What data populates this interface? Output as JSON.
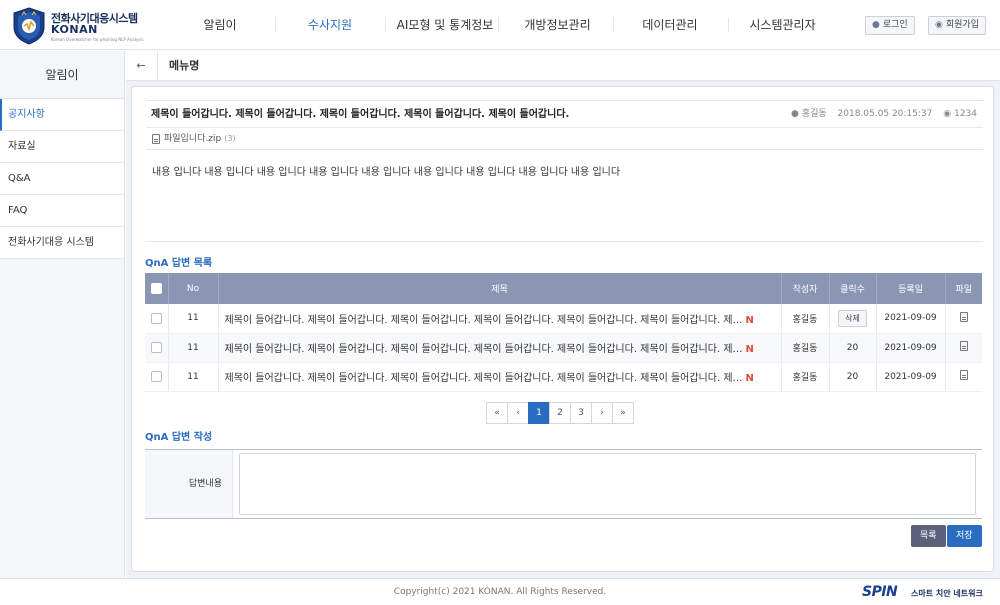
{
  "app": {
    "logo_title": "전화사기대응시스템",
    "logo_name": "KONAN",
    "logo_tagline": "Korean Overwatcher for phishing NLP Analysis"
  },
  "gnb": [
    {
      "label": "알림이",
      "active": false
    },
    {
      "label": "수사지원",
      "active": true
    },
    {
      "label": "AI모형 및 통계정보",
      "active": false
    },
    {
      "label": "개방정보관리",
      "active": false
    },
    {
      "label": "데이터관리",
      "active": false
    },
    {
      "label": "시스템관리자",
      "active": false
    }
  ],
  "top_buttons": {
    "login": "로그인",
    "signup": "회원가입"
  },
  "sidebar": {
    "title": "알림이",
    "items": [
      {
        "label": "공지사항",
        "active": true
      },
      {
        "label": "자료실",
        "active": false
      },
      {
        "label": "Q&A",
        "active": false
      },
      {
        "label": "FAQ",
        "active": false
      },
      {
        "label": "전화사기대응 시스템",
        "active": false
      }
    ]
  },
  "breadcrumb": {
    "title": "메뉴명"
  },
  "post": {
    "title": "제목이 들어갑니다. 제목이 들어갑니다. 제목이 들어갑니다. 제목이 들어갑니다. 제목이 들어갑니다.",
    "author": "홍길동",
    "date": "2018.05.05 20:15:37",
    "views": "1234",
    "file_name": "파일입니다.zip",
    "file_size": "(3)",
    "body": "내용 입니다 내용 입니다 내용 입니다 내용 입니다 내용 입니다 내용 입니다 내용 입니다 내용 입니다 내용 입니다"
  },
  "answers": {
    "section_title": "QnA 답변 목록",
    "headers": [
      "No",
      "제목",
      "작성자",
      "클릭수",
      "등록일",
      "파일"
    ],
    "rows": [
      {
        "no": "11",
        "title": "제목이 들어갑니다. 제목이 들어갑니다. 제목이 들어갑니다. 제목이 들어갑니다. 제목이 들어갑니다. 제목이 들어갑니다. 제…",
        "new": "N",
        "author": "홍길동",
        "clicks": "삭제",
        "clicks_is_button": true,
        "date": "2021-09-09"
      },
      {
        "no": "11",
        "title": "제목이 들어갑니다. 제목이 들어갑니다. 제목이 들어갑니다. 제목이 들어갑니다. 제목이 들어갑니다. 제목이 들어갑니다. 제…",
        "new": "N",
        "author": "홍길동",
        "clicks": "20",
        "clicks_is_button": false,
        "date": "2021-09-09"
      },
      {
        "no": "11",
        "title": "제목이 들어갑니다. 제목이 들어갑니다. 제목이 들어갑니다. 제목이 들어갑니다. 제목이 들어갑니다. 제목이 들어갑니다. 제…",
        "new": "N",
        "author": "홍길동",
        "clicks": "20",
        "clicks_is_button": false,
        "date": "2021-09-09"
      }
    ]
  },
  "pagination": {
    "first": "«",
    "prev": "‹",
    "pages": [
      "1",
      "2",
      "3"
    ],
    "current": "1",
    "next": "›",
    "last": "»"
  },
  "answer_form": {
    "section_title": "QnA 답변 작성",
    "label": "답변내용",
    "value": "",
    "list_button": "목록",
    "save_button": "저장"
  },
  "footer": {
    "copyright": "Copyright(c) 2021 KONAN. All Rights Reserved.",
    "brand": "SPIN",
    "brand_sub": "스마트 치안 네트워크"
  },
  "colors": {
    "accent": "#2a6cc2",
    "table_header": "#8a96b3",
    "list_button": "#5b6178",
    "new_badge": "#e04a3a"
  },
  "icons": {
    "user": "user-icon",
    "views": "eye-icon",
    "file": "file-icon",
    "back": "arrow-left-icon"
  }
}
